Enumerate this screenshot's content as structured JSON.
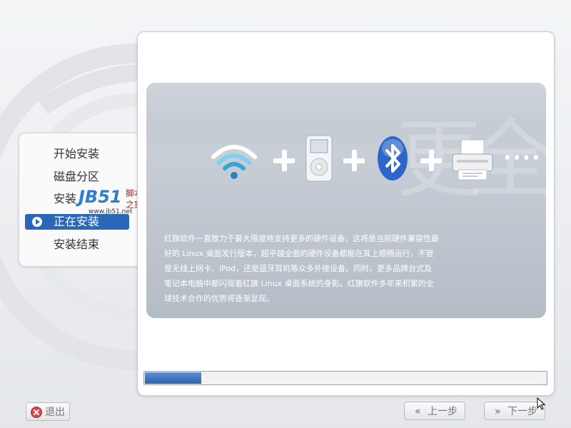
{
  "steps": [
    {
      "label": "开始安装",
      "active": false
    },
    {
      "label": "磁盘分区",
      "active": false
    },
    {
      "label": "安装",
      "active": false
    },
    {
      "label": "正在安装",
      "active": true
    },
    {
      "label": "安装结束",
      "active": false
    }
  ],
  "slide": {
    "ghost_text": "更全",
    "icons": [
      "wifi-icon",
      "ipod-icon",
      "bluetooth-icon",
      "printer-icon"
    ],
    "ellipsis": "····",
    "description": "红旗软件一直致力于最大限度地支持更多的硬件设备，这将是当前硬件兼容性最好的 Linux 桌面发行版本，超乎越全面的硬件设备都能在其上顺畅运行，不管是无线上网卡、iPod，还是蓝牙耳机等众多外接设备。同时，更多品牌台式及笔记本电脑中都闪现着红旗 Linux 桌面系统的身影。红旗软件多年来积累的全球技术合作的优势将逐渐显现。"
  },
  "progress": {
    "fraction": 0.14
  },
  "buttons": {
    "quit": "退出",
    "back": "上一步",
    "next": "下一步",
    "back_chevron": "«",
    "next_chevron": "»"
  },
  "watermark": {
    "logo": "JB51",
    "cn_line1": "脚本",
    "cn_line2": "之家",
    "url": "www.jb51.net"
  },
  "colors": {
    "accent": "#2a67b8",
    "progress": "#2a5fae",
    "slide_bg": "#bfc6ce"
  }
}
